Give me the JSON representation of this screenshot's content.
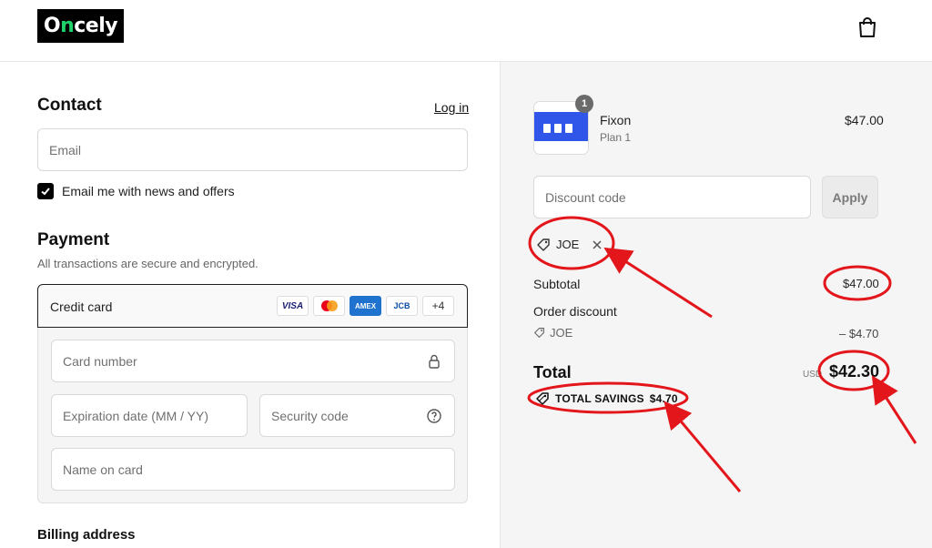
{
  "header": {
    "logo_prefix": "O",
    "logo_accent": "n",
    "logo_suffix": "cely",
    "cart_icon": "shopping-bag-icon"
  },
  "contact": {
    "title": "Contact",
    "login_label": "Log in",
    "email_placeholder": "Email",
    "newsletter_label": "Email me with news and offers",
    "newsletter_checked": true
  },
  "payment": {
    "title": "Payment",
    "subtitle": "All transactions are secure and encrypted.",
    "method_label": "Credit card",
    "card_brands": [
      "VISA",
      "Mastercard",
      "AMEX",
      "JCB",
      "+4"
    ],
    "card_number_placeholder": "Card number",
    "expiry_placeholder": "Expiration date (MM / YY)",
    "security_placeholder": "Security code",
    "name_placeholder": "Name on card"
  },
  "billing": {
    "title": "Billing address"
  },
  "order": {
    "item": {
      "name": "Fixon",
      "variant": "Plan 1",
      "price": "$47.00",
      "quantity": "1"
    },
    "discount_placeholder": "Discount code",
    "apply_label": "Apply",
    "applied_code": "JOE",
    "subtotal_label": "Subtotal",
    "subtotal_value": "$47.00",
    "order_discount_label": "Order discount",
    "order_discount_code": "JOE",
    "order_discount_value": "– $4.70",
    "total_label": "Total",
    "currency": "USD",
    "total_value": "$42.30",
    "savings_label": "TOTAL SAVINGS",
    "savings_value": "$4.70"
  },
  "colors": {
    "annotation": "#e3161b",
    "accent": "#1fd36b",
    "brand_blue": "#2f56e8"
  }
}
